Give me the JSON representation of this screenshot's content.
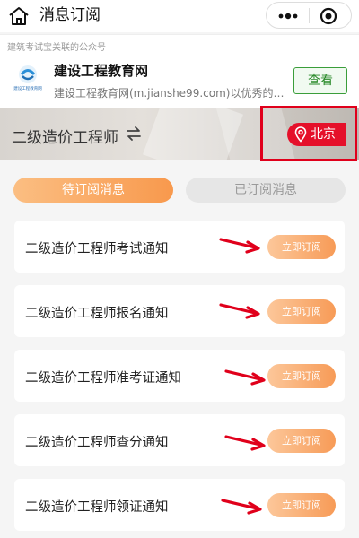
{
  "header": {
    "title": "消息订阅"
  },
  "official_account": {
    "hint": "建筑考试宝关联的公众号",
    "logo_text": "建设工程教育网",
    "name": "建设工程教育网",
    "description": "建设工程教育网(m.jianshe99.com)以优秀的…",
    "follow_label": "查看"
  },
  "banner": {
    "exam_name": "二级造价工程师",
    "city": "北京"
  },
  "tabs": {
    "pending": "待订阅消息",
    "subscribed": "已订阅消息"
  },
  "notices": [
    {
      "label": "二级造价工程师考试通知",
      "button": "立即订阅"
    },
    {
      "label": "二级造价工程师报名通知",
      "button": "立即订阅"
    },
    {
      "label": "二级造价工程师准考证通知",
      "button": "立即订阅"
    },
    {
      "label": "二级造价工程师查分通知",
      "button": "立即订阅"
    },
    {
      "label": "二级造价工程师领证通知",
      "button": "立即订阅"
    }
  ],
  "colors": {
    "accent_orange": "#f8994d",
    "alert_red": "#e5102a",
    "follow_green": "#2a8a2a"
  }
}
